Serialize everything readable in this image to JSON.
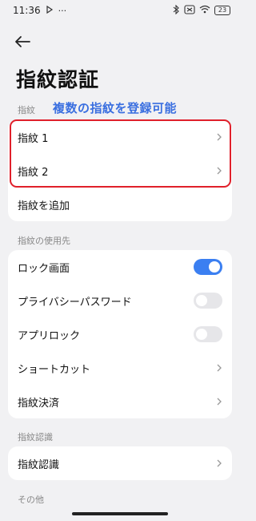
{
  "status_bar": {
    "time": "11:36",
    "battery": "23"
  },
  "page": {
    "title": "指紋認証"
  },
  "annotation": "複数の指紋を登録可能",
  "sections": {
    "fingerprint": {
      "label": "指紋",
      "items": [
        "指紋 1",
        "指紋 2",
        "指紋を追加"
      ]
    },
    "usage": {
      "label": "指紋の使用先",
      "items": [
        {
          "label": "ロック画面",
          "toggle": true
        },
        {
          "label": "プライバシーパスワード",
          "toggle": false
        },
        {
          "label": "アプリロック",
          "toggle": false
        },
        {
          "label": "ショートカット"
        },
        {
          "label": "指紋決済"
        }
      ]
    },
    "recognition": {
      "label": "指紋認識",
      "items": [
        "指紋認識"
      ]
    },
    "other": {
      "label": "その他"
    }
  },
  "colors": {
    "accent": "#3b7ff1",
    "annotation": "#3a6fe0",
    "highlight": "#e0202b"
  }
}
